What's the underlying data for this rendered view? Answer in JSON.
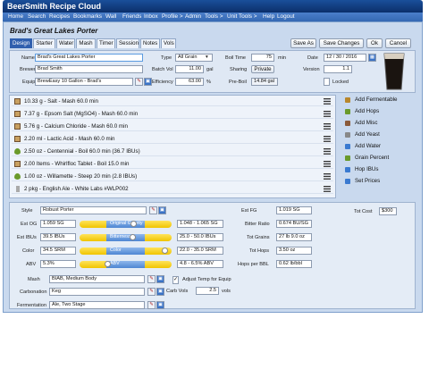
{
  "app": {
    "title": "BeerSmith Recipe Cloud"
  },
  "nav": [
    "Home",
    "Search",
    "Recipes",
    "Bookmarks",
    "Wall",
    "Friends",
    "Inbox",
    "Profile >",
    "Admin",
    "Tools >",
    "Unit Tools >",
    "Help",
    "Logout"
  ],
  "recipe": {
    "title": "Brad's Great Lakes Porter"
  },
  "tabs": [
    "Design",
    "Starter",
    "Water",
    "Mash",
    "Timer",
    "Session",
    "Notes",
    "Vols"
  ],
  "actions": {
    "save_as": "Save As",
    "save_changes": "Save Changes",
    "ok": "Ok",
    "cancel": "Cancel"
  },
  "details": {
    "name_label": "Name",
    "name": "Brad's Great Lakes Porter",
    "brewer_label": "Brewer",
    "brewer": "Brad Smith",
    "equip_label": "Equip",
    "equip": "BrewEasy 10 Gallon - Brad's",
    "type_label": "Type",
    "type": "All Grain",
    "batch_label": "Batch Vol",
    "batch": "11.00",
    "batch_unit": "gal",
    "eff_label": "Efficiency",
    "eff": "63.00",
    "eff_unit": "%",
    "boil_label": "Boil Time",
    "boil": "75",
    "boil_unit": "min",
    "sharing_label": "Sharing",
    "sharing": "Private",
    "preboil_label": "Pre-Boil",
    "preboil": "14.84 gal",
    "date_label": "Date",
    "date": "12 / 30 / 2016",
    "version_label": "Version",
    "version": "1.1",
    "locked_label": "Locked"
  },
  "ingredients": [
    {
      "text": "10.33 g - Salt - Mash 60.0 min",
      "icon": "misc-icon"
    },
    {
      "text": "7.37 g - Epsom Salt (MgSO4) - Mash 60.0 min",
      "icon": "misc-icon"
    },
    {
      "text": "5.76 g - Calcium Chloride - Mash 60.0 min",
      "icon": "misc-icon"
    },
    {
      "text": "2.20 ml - Lactic Acid - Mash 60.0 min",
      "icon": "misc-icon"
    },
    {
      "text": "2.50 oz - Centennial - Boil 60.0 min (36.7 IBUs)",
      "icon": "hop-icon"
    },
    {
      "text": "2.00 Items - Whirlfloc Tablet - Boil 15.0 min",
      "icon": "misc-icon"
    },
    {
      "text": "1.00 oz - Willamette - Steep 20 min (2.8 IBUs)",
      "icon": "hop-icon"
    },
    {
      "text": "2 pkg - English Ale - White Labs #WLP002",
      "icon": "yeast-icon"
    }
  ],
  "side_buttons": [
    {
      "label": "Add Fermentable",
      "color": "#b8862b"
    },
    {
      "label": "Add Hops",
      "color": "#6a9a2a"
    },
    {
      "label": "Add Misc",
      "color": "#8a5a3a"
    },
    {
      "label": "Add Yeast",
      "color": "#888888"
    },
    {
      "label": "Add Water",
      "color": "#3a7ad0"
    },
    {
      "label": "Grain Percent",
      "color": "#6a9a2a"
    },
    {
      "label": "Hop IBUs",
      "color": "#3a7ad0"
    },
    {
      "label": "Set Prices",
      "color": "#3a7ad0"
    }
  ],
  "stats": {
    "style_label": "Style",
    "style": "Robust Porter",
    "og_label": "Est OG",
    "og": "1.059 SG",
    "og_gauge": "Original Gravity",
    "og_range": "1.048 - 1.065 SG",
    "og_pos": 0.59,
    "ibu_label": "Est IBUs",
    "ibu": "39.5 IBUs",
    "ibu_gauge": "Bitterness",
    "ibu_range": "25.0 - 50.0 IBUs",
    "ibu_pos": 0.58,
    "color_label": "Color",
    "color": "34.5 SRM",
    "color_gauge": "Color",
    "color_range": "22.0 - 35.0 SRM",
    "color_pos": 0.96,
    "abv_label": "ABV",
    "abv": "5.3%",
    "abv_gauge": "ABV",
    "abv_range": "4.8 - 6.5% ABV",
    "abv_pos": 0.29,
    "fg_label": "Est FG",
    "fg": "1.019 SG",
    "ratio_label": "Bitter Ratio",
    "ratio": "0.674 BU/SG",
    "grains_label": "Tot Grains",
    "grains": "27 lb 9.0 oz",
    "hops_label": "Tot Hops",
    "hops": "3.50 oz",
    "hpb_label": "Hops per BBL",
    "hpb": "0.62 lb/bbl",
    "cost_label": "Tot Cost",
    "cost": "$300",
    "mash_label": "Mash",
    "mash": "BIAB, Medium Body",
    "adjust_label": "Adjust Temp for Equip",
    "carb_label": "Carbonation",
    "carb": "Keg",
    "carbvol_label": "Carb Vols",
    "carbvol": "2.5",
    "carbvol_unit": "vols",
    "ferm_label": "Fermentation",
    "ferm": "Ale, Two Stage"
  }
}
